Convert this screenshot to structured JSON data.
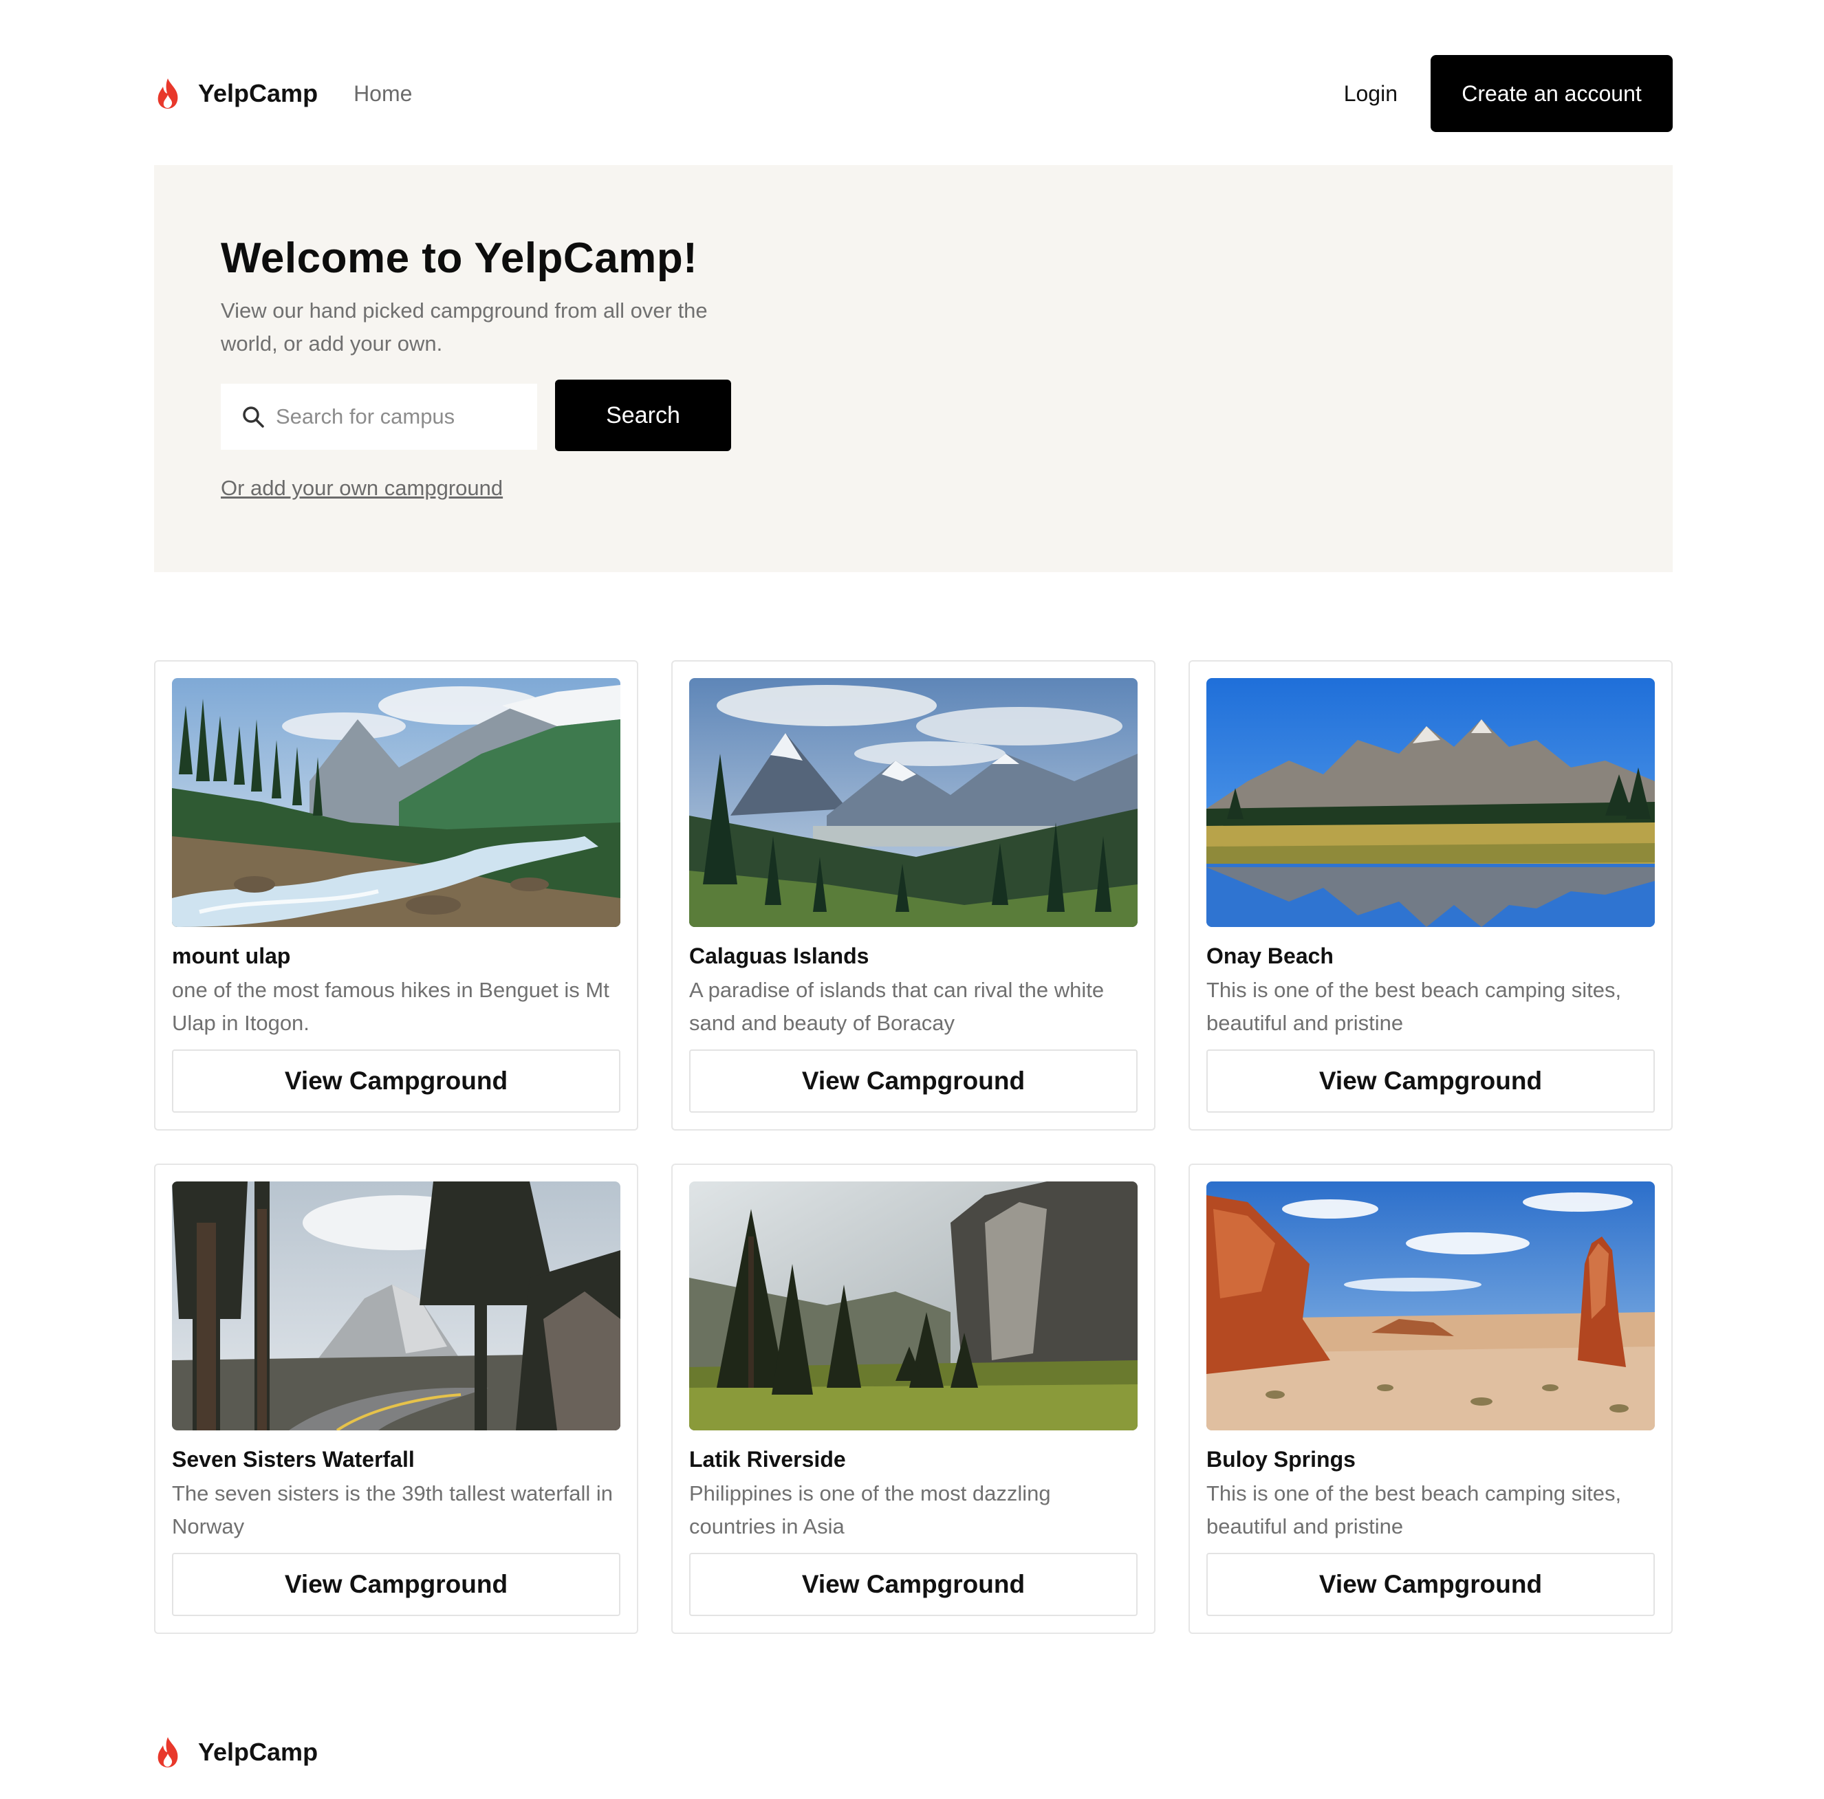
{
  "header": {
    "brand": "YelpCamp",
    "nav_home": "Home",
    "login": "Login",
    "create_account": "Create an account"
  },
  "hero": {
    "title": "Welcome to YelpCamp!",
    "subtitle": "View our hand picked campground from all over the world, or add your own.",
    "search_placeholder": "Search for campus",
    "search_button": "Search",
    "add_link": "Or add your own campground"
  },
  "campgrounds": [
    {
      "title": "mount ulap",
      "description": "one of the most famous hikes in Benguet is Mt Ulap in Itogon.",
      "button": "View Campground",
      "image_icon": "mountain-river-photo"
    },
    {
      "title": "Calaguas Islands",
      "description": "A paradise of islands that can rival the white sand and beauty of Boracay",
      "button": "View Campground",
      "image_icon": "mountain-valley-photo"
    },
    {
      "title": "Onay Beach",
      "description": "This is one of the best beach camping sites, beautiful and pristine",
      "button": "View Campground",
      "image_icon": "mountain-lake-photo"
    },
    {
      "title": "Seven Sisters Waterfall",
      "description": "The seven sisters is the 39th tallest waterfall in Norway",
      "button": "View Campground",
      "image_icon": "forest-road-photo"
    },
    {
      "title": "Latik Riverside",
      "description": "Philippines is one of the most dazzling countries in Asia",
      "button": "View Campground",
      "image_icon": "cliff-forest-photo"
    },
    {
      "title": "Buloy Springs",
      "description": "This is one of the best beach camping sites, beautiful and pristine",
      "button": "View Campground",
      "image_icon": "desert-rock-photo"
    }
  ],
  "footer": {
    "brand": "YelpCamp"
  },
  "colors": {
    "accent": "#000000",
    "flame": "#e8382b",
    "hero_bg": "#f7f5f1",
    "muted_text": "#707070"
  }
}
